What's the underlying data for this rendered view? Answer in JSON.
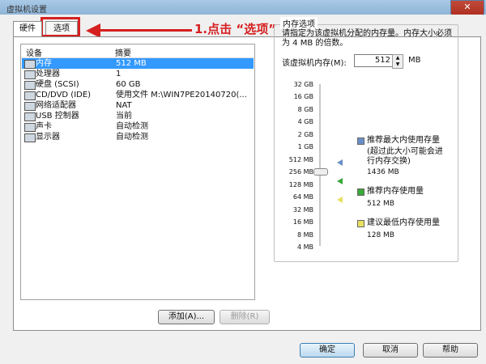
{
  "window": {
    "title": "虚拟机设置"
  },
  "tabs": [
    {
      "label": "硬件"
    },
    {
      "label": "选项"
    }
  ],
  "annotation": {
    "text": "1.点击 “选项”"
  },
  "device_list": {
    "headers": {
      "device": "设备",
      "summary": "摘要"
    },
    "rows": [
      {
        "name": "内存",
        "summary": "512 MB",
        "selected": true
      },
      {
        "name": "处理器",
        "summary": "1"
      },
      {
        "name": "硬盘 (SCSI)",
        "summary": "60 GB"
      },
      {
        "name": "CD/DVD (IDE)",
        "summary": "使用文件 M:\\WIN7PE20140720(..."
      },
      {
        "name": "网络适配器",
        "summary": "NAT"
      },
      {
        "name": "USB 控制器",
        "summary": "当前"
      },
      {
        "name": "声卡",
        "summary": "自动检测"
      },
      {
        "name": "显示器",
        "summary": "自动检测"
      }
    ]
  },
  "buttons": {
    "add": "添加(A)...",
    "remove": "删除(R)",
    "ok": "确定",
    "cancel": "取消",
    "help": "帮助"
  },
  "memory": {
    "group_title": "内存选项",
    "description": "请指定为该虚拟机分配的内存量。内存大小必须为 4 MB 的倍数。",
    "label": "该虚拟机内存(M):",
    "value": "512",
    "unit": "MB",
    "scale": [
      "32 GB",
      "16 GB",
      "8 GB",
      "4 GB",
      "2 GB",
      "1 GB",
      "512 MB",
      "256 MB",
      "128 MB",
      "64 MB",
      "32 MB",
      "16 MB",
      "8 MB",
      "4 MB"
    ],
    "legend": [
      {
        "label": "推荐最大内使用存量",
        "note": "(超过此大小可能会进行内存交换)",
        "value": "1436 MB",
        "color": "#6a8fc8"
      },
      {
        "label": "推荐内存使用量",
        "value": "512 MB",
        "color": "#3aa83a"
      },
      {
        "label": "建议最低内存使用量",
        "value": "128 MB",
        "color": "#e8e060"
      }
    ]
  }
}
